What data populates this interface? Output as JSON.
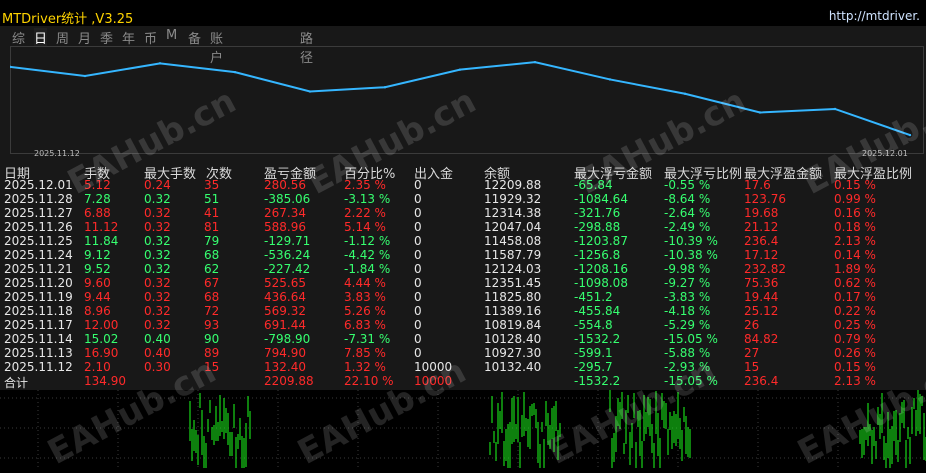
{
  "header": {
    "title": "MTDriver统计 ,V3.25",
    "url": "http://mtdriver."
  },
  "tabs": [
    {
      "label": "综",
      "active": false
    },
    {
      "label": "日",
      "active": true
    },
    {
      "label": "周",
      "active": false
    },
    {
      "label": "月",
      "active": false
    },
    {
      "label": "季",
      "active": false
    },
    {
      "label": "年",
      "active": false
    },
    {
      "label": "币",
      "active": false
    },
    {
      "label": "M",
      "active": false
    },
    {
      "label": "备",
      "active": false
    },
    {
      "label": "账户",
      "active": false
    },
    {
      "label": "路径",
      "active": false
    }
  ],
  "equity_chart": {
    "start_date": "2025.11.12",
    "end_date": "2025.12.01",
    "values": [
      10132.4,
      10927.3,
      10819.84,
      11389.16,
      11825.8,
      12351.45,
      12124.03,
      11587.79,
      11458.08,
      12047.04,
      12314.38,
      11929.32,
      12209.88
    ]
  },
  "table": {
    "columns": [
      "日期",
      "手数",
      "最大手数",
      "次数",
      "盈亏金额",
      "百分比%",
      "出入金",
      "余额",
      "最大浮亏金额",
      "最大浮亏比例",
      "最大浮盈金额",
      "最大浮盈比例"
    ],
    "rows": [
      {
        "date": "2025.12.01",
        "lots": "5.12",
        "maxlots": "0.24",
        "count": "35",
        "pnl": "280.56",
        "pct": "2.35 %",
        "inout": "0",
        "bal": "12209.88",
        "ddamt": "-65.84",
        "ddpct": "-0.55 %",
        "fpamt": "17.6",
        "fppct": "0.15 %",
        "dir": "red"
      },
      {
        "date": "2025.11.28",
        "lots": "7.28",
        "maxlots": "0.32",
        "count": "51",
        "pnl": "-385.06",
        "pct": "-3.13 %",
        "inout": "0",
        "bal": "11929.32",
        "ddamt": "-1084.64",
        "ddpct": "-8.64 %",
        "fpamt": "123.76",
        "fppct": "0.99 %",
        "dir": "green"
      },
      {
        "date": "2025.11.27",
        "lots": "6.88",
        "maxlots": "0.32",
        "count": "41",
        "pnl": "267.34",
        "pct": "2.22 %",
        "inout": "0",
        "bal": "12314.38",
        "ddamt": "-321.76",
        "ddpct": "-2.64 %",
        "fpamt": "19.68",
        "fppct": "0.16 %",
        "dir": "red"
      },
      {
        "date": "2025.11.26",
        "lots": "11.12",
        "maxlots": "0.32",
        "count": "81",
        "pnl": "588.96",
        "pct": "5.14 %",
        "inout": "0",
        "bal": "12047.04",
        "ddamt": "-298.88",
        "ddpct": "-2.49 %",
        "fpamt": "21.12",
        "fppct": "0.18 %",
        "dir": "red"
      },
      {
        "date": "2025.11.25",
        "lots": "11.84",
        "maxlots": "0.32",
        "count": "79",
        "pnl": "-129.71",
        "pct": "-1.12 %",
        "inout": "0",
        "bal": "11458.08",
        "ddamt": "-1203.87",
        "ddpct": "-10.39 %",
        "fpamt": "236.4",
        "fppct": "2.13 %",
        "dir": "green"
      },
      {
        "date": "2025.11.24",
        "lots": "9.12",
        "maxlots": "0.32",
        "count": "68",
        "pnl": "-536.24",
        "pct": "-4.42 %",
        "inout": "0",
        "bal": "11587.79",
        "ddamt": "-1256.8",
        "ddpct": "-10.38 %",
        "fpamt": "17.12",
        "fppct": "0.14 %",
        "dir": "green"
      },
      {
        "date": "2025.11.21",
        "lots": "9.52",
        "maxlots": "0.32",
        "count": "62",
        "pnl": "-227.42",
        "pct": "-1.84 %",
        "inout": "0",
        "bal": "12124.03",
        "ddamt": "-1208.16",
        "ddpct": "-9.98 %",
        "fpamt": "232.82",
        "fppct": "1.89 %",
        "dir": "green"
      },
      {
        "date": "2025.11.20",
        "lots": "9.60",
        "maxlots": "0.32",
        "count": "67",
        "pnl": "525.65",
        "pct": "4.44 %",
        "inout": "0",
        "bal": "12351.45",
        "ddamt": "-1098.08",
        "ddpct": "-9.27 %",
        "fpamt": "75.36",
        "fppct": "0.62 %",
        "dir": "red"
      },
      {
        "date": "2025.11.19",
        "lots": "9.44",
        "maxlots": "0.32",
        "count": "68",
        "pnl": "436.64",
        "pct": "3.83 %",
        "inout": "0",
        "bal": "11825.80",
        "ddamt": "-451.2",
        "ddpct": "-3.83 %",
        "fpamt": "19.44",
        "fppct": "0.17 %",
        "dir": "red"
      },
      {
        "date": "2025.11.18",
        "lots": "8.96",
        "maxlots": "0.32",
        "count": "72",
        "pnl": "569.32",
        "pct": "5.26 %",
        "inout": "0",
        "bal": "11389.16",
        "ddamt": "-455.84",
        "ddpct": "-4.18 %",
        "fpamt": "25.12",
        "fppct": "0.22 %",
        "dir": "red"
      },
      {
        "date": "2025.11.17",
        "lots": "12.00",
        "maxlots": "0.32",
        "count": "93",
        "pnl": "691.44",
        "pct": "6.83 %",
        "inout": "0",
        "bal": "10819.84",
        "ddamt": "-554.8",
        "ddpct": "-5.29 %",
        "fpamt": "26",
        "fppct": "0.25 %",
        "dir": "red"
      },
      {
        "date": "2025.11.14",
        "lots": "15.02",
        "maxlots": "0.40",
        "count": "90",
        "pnl": "-798.90",
        "pct": "-7.31 %",
        "inout": "0",
        "bal": "10128.40",
        "ddamt": "-1532.2",
        "ddpct": "-15.05 %",
        "fpamt": "84.82",
        "fppct": "0.79 %",
        "dir": "green"
      },
      {
        "date": "2025.11.13",
        "lots": "16.90",
        "maxlots": "0.40",
        "count": "89",
        "pnl": "794.90",
        "pct": "7.85 %",
        "inout": "0",
        "bal": "10927.30",
        "ddamt": "-599.1",
        "ddpct": "-5.88 %",
        "fpamt": "27",
        "fppct": "0.26 %",
        "dir": "red"
      },
      {
        "date": "2025.11.12",
        "lots": "2.10",
        "maxlots": "0.30",
        "count": "15",
        "pnl": "132.40",
        "pct": "1.32 %",
        "inout": "10000",
        "bal": "10132.40",
        "ddamt": "-295.7",
        "ddpct": "-2.93 %",
        "fpamt": "15",
        "fppct": "0.15 %",
        "dir": "red"
      }
    ],
    "total": {
      "label": "合计",
      "lots": "134.90",
      "pnl": "2209.88",
      "pct": "22.10 %",
      "inout": "10000",
      "ddamt": "-1532.2",
      "ddpct": "-15.05 %",
      "fpamt": "236.4",
      "fppct": "2.13 %"
    }
  },
  "watermark_text": "EAHub.cn",
  "colors": {
    "line": "#35b6ff",
    "grid": "#3b3b3b",
    "profit": "#ff2a2a",
    "loss": "#36ff70",
    "title": "#ffd400"
  }
}
